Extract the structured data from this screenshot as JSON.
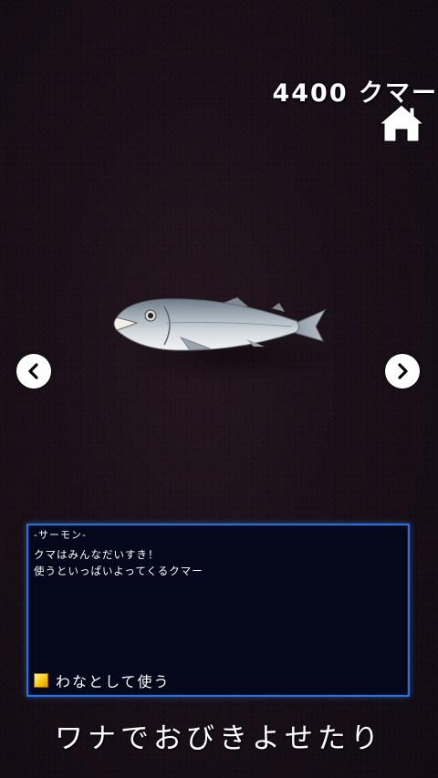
{
  "header": {
    "currency_text": "4400 クマー"
  },
  "item": {
    "name": "-サーモン-",
    "description": [
      "クマはみんなだいすき！",
      "使うといっぱいよってくるクマー"
    ]
  },
  "use_option": {
    "label": "わなとして使う",
    "checked": true,
    "checkbox_color": "#ffd21f"
  },
  "caption": "ワナでおびきよせたり",
  "colors": {
    "panel_border": "#2d6fd6",
    "panel_background": "#05081a",
    "background": "#1a1019"
  },
  "icons": {
    "home": "home-icon",
    "prev": "chevron-left-icon",
    "next": "chevron-right-icon",
    "item": "salmon-fish-icon"
  }
}
